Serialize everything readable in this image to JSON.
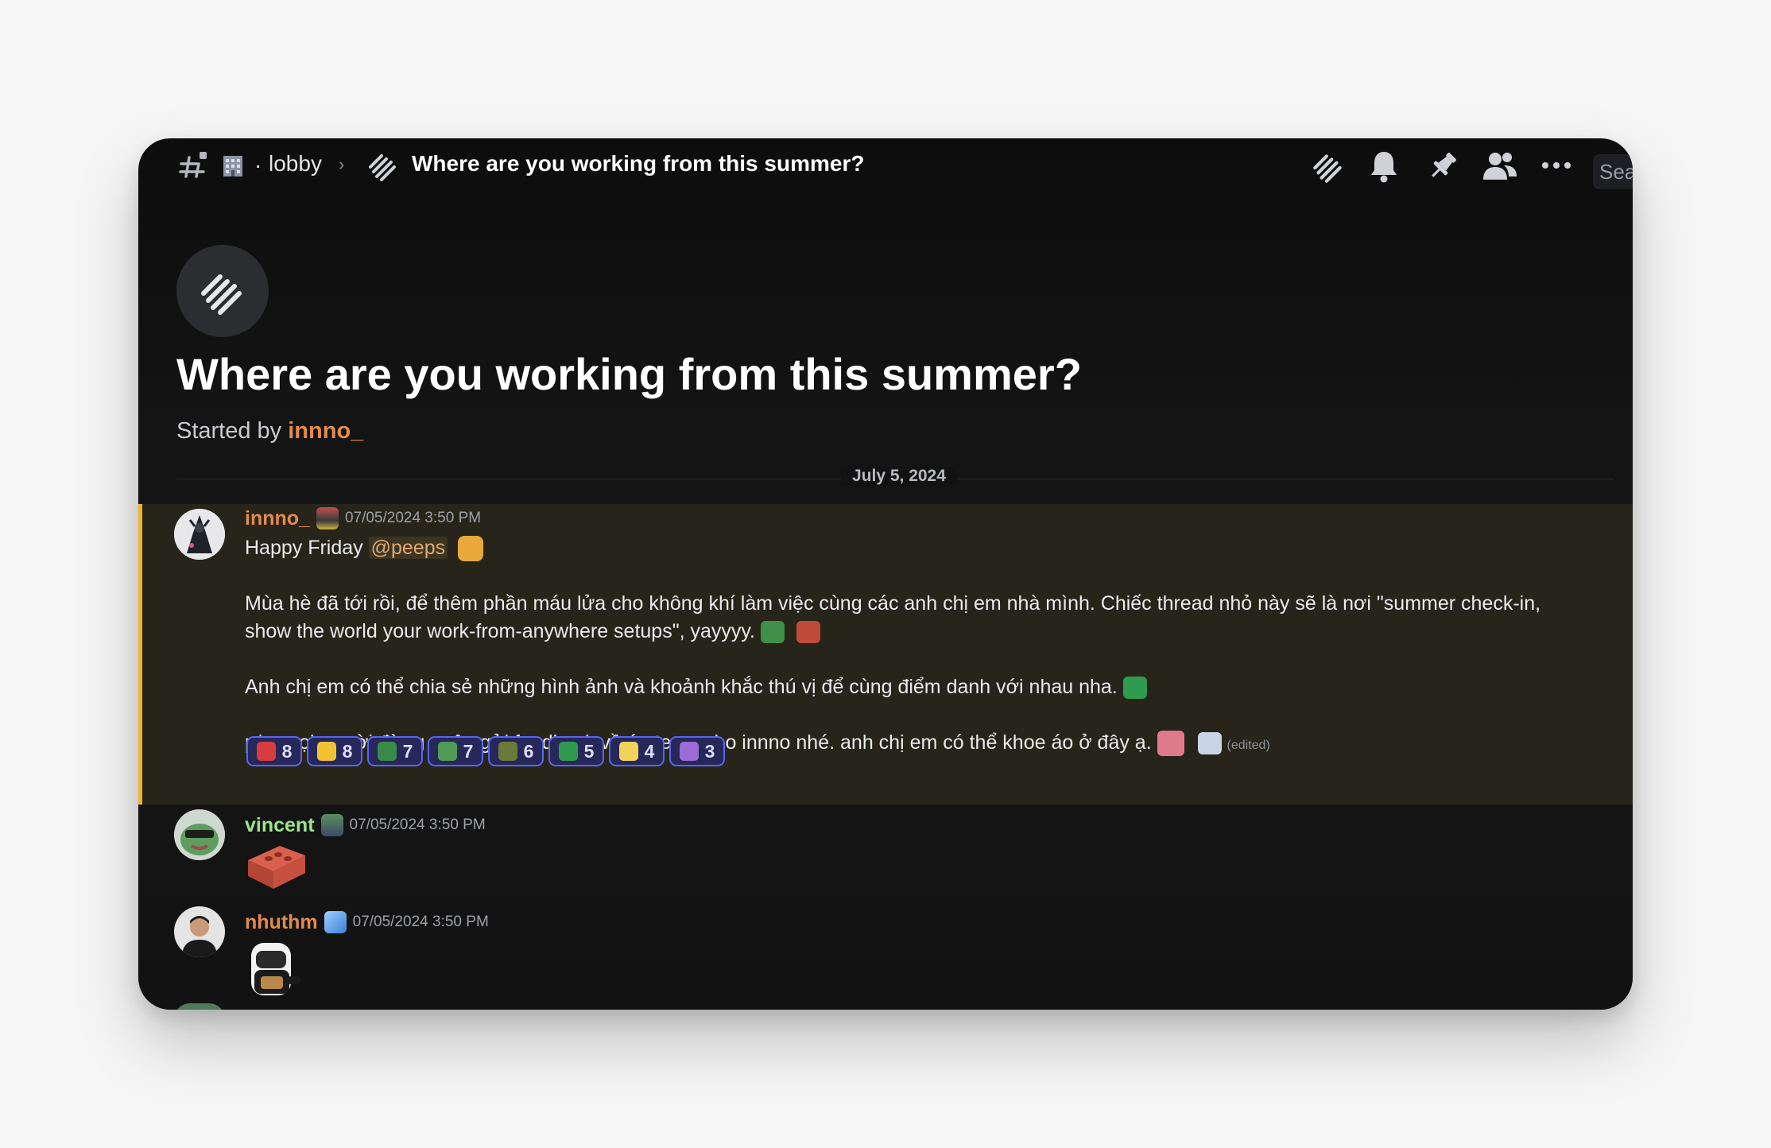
{
  "header": {
    "channel_emoji": "office-building-emoji",
    "channel_name": "lobby",
    "separator_dot": "·",
    "breadcrumb_chevron": "›",
    "thread_title": "Where are you working from this summer?",
    "search_placeholder": "Sea"
  },
  "hero": {
    "title": "Where are you working from this summer?",
    "started_by_prefix": "Started by ",
    "started_by_author": "innno_"
  },
  "date_divider": "July 5, 2024",
  "messages": [
    {
      "username": "innno_",
      "username_color": "#e38b4f",
      "timestamp": "07/05/2024 3:50 PM",
      "line1_text": "Happy Friday ",
      "mention": "@peeps",
      "para2": "Mùa hè đã tới rồi, để thêm phần máu lửa cho không khí làm việc cùng các anh chị em nhà mình. Chiếc thread nhỏ này sẽ là nơi \"summer check-in, show the world your work-from-anywhere setups\", yayyyy.",
      "para3": "Anh chị em có thể chia sẻ những hình ảnh và khoảnh khắc thú vị để cùng điểm danh với nhau nha.",
      "para4": "p/s: mọi người đừng quên gửi feedback về áo team cho innno nhé. anh chị em có thể khoe áo ở đây ạ.",
      "edited": "(edited)",
      "reactions": [
        {
          "emoji": "heart-emoji",
          "count": "8",
          "color": "#d83c3e"
        },
        {
          "emoji": "pray-emoji",
          "count": "8",
          "color": "#f1c232"
        },
        {
          "emoji": "pepe-emoji",
          "count": "7",
          "color": "#3a8a4a"
        },
        {
          "emoji": "pepe-happy-emoji",
          "count": "7",
          "color": "#4f9a55"
        },
        {
          "emoji": "helmet-emoji",
          "count": "6",
          "color": "#6b7a3a"
        },
        {
          "emoji": "frog-laptop-emoji",
          "count": "5",
          "color": "#2e9b4e"
        },
        {
          "emoji": "duck-emoji",
          "count": "4",
          "color": "#f3d25b"
        },
        {
          "emoji": "tag-emoji",
          "count": "3",
          "color": "#9b6bd6"
        }
      ]
    },
    {
      "username": "vincent",
      "username_color": "#9be58a",
      "timestamp": "07/05/2024 3:50 PM",
      "attachment": "brick-sticker"
    },
    {
      "username": "nhuthm",
      "username_color": "#e38b4f",
      "timestamp": "07/05/2024 3:50 PM",
      "attachment": "air-fryer-sticker"
    }
  ]
}
